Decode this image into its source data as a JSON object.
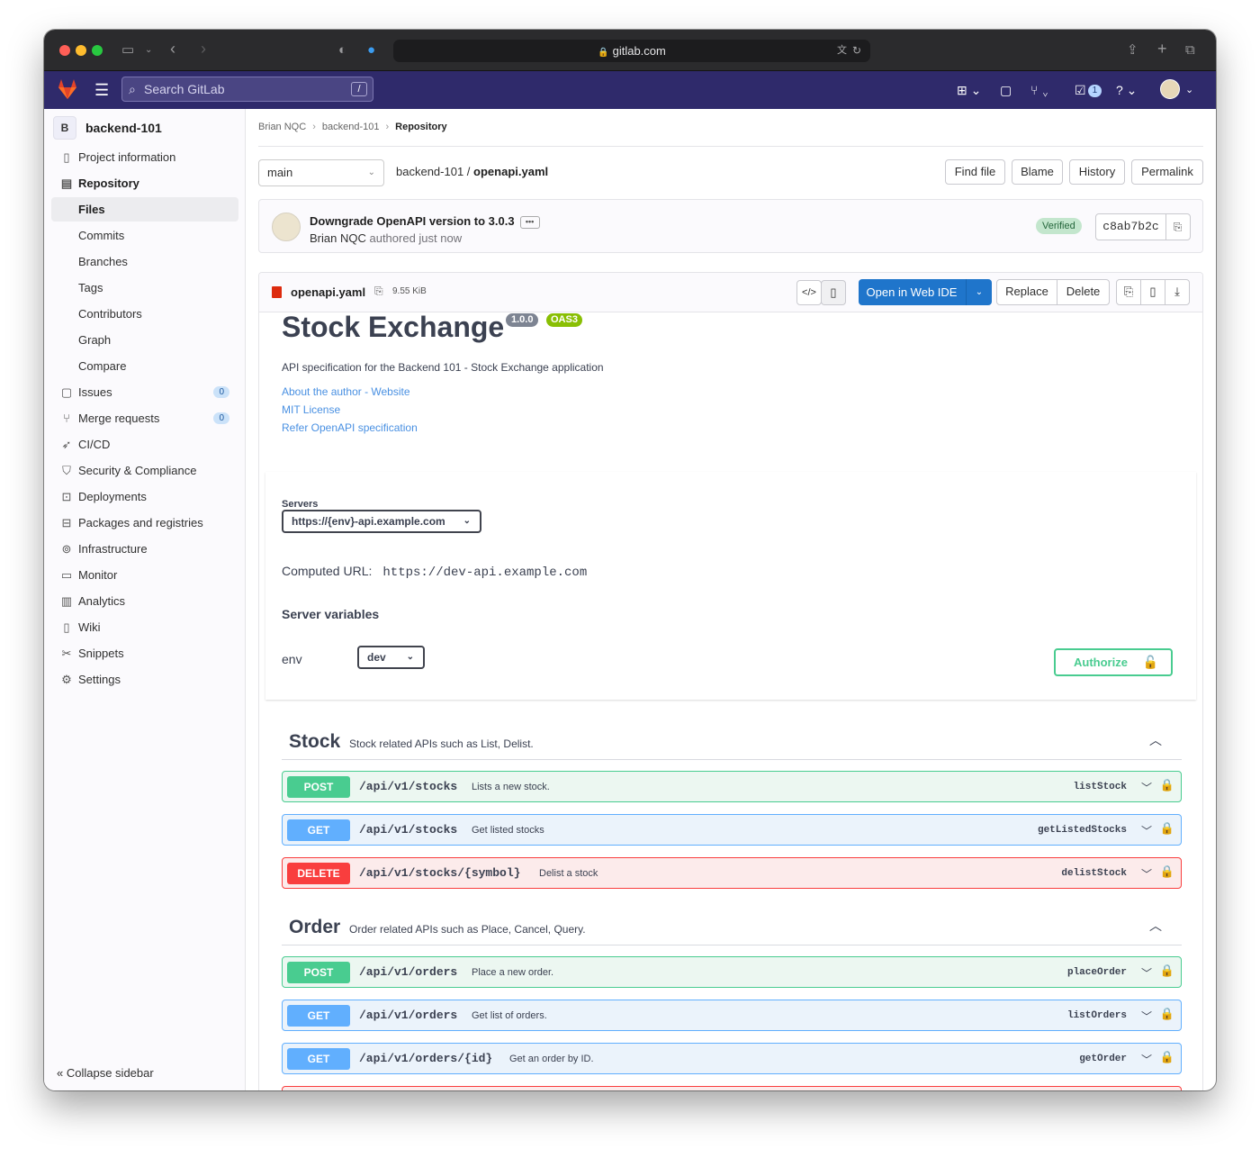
{
  "browser": {
    "url": "gitlab.com"
  },
  "topnav": {
    "search_placeholder": "Search GitLab",
    "search_shortcut": "/",
    "todo_count": "1"
  },
  "sidebar": {
    "project_initial": "B",
    "project_name": "backend-101",
    "items": [
      {
        "label": "Project information",
        "icon": "info-icon"
      },
      {
        "label": "Repository",
        "icon": "doc-icon"
      },
      {
        "label": "Files"
      },
      {
        "label": "Commits"
      },
      {
        "label": "Branches"
      },
      {
        "label": "Tags"
      },
      {
        "label": "Contributors"
      },
      {
        "label": "Graph"
      },
      {
        "label": "Compare"
      },
      {
        "label": "Issues",
        "icon": "issues-icon",
        "badge": "0"
      },
      {
        "label": "Merge requests",
        "icon": "merge-icon",
        "badge": "0"
      },
      {
        "label": "CI/CD",
        "icon": "rocket-icon"
      },
      {
        "label": "Security & Compliance",
        "icon": "shield-icon"
      },
      {
        "label": "Deployments",
        "icon": "deploy-icon"
      },
      {
        "label": "Packages and registries",
        "icon": "package-icon"
      },
      {
        "label": "Infrastructure",
        "icon": "cloud-icon"
      },
      {
        "label": "Monitor",
        "icon": "monitor-icon"
      },
      {
        "label": "Analytics",
        "icon": "chart-icon"
      },
      {
        "label": "Wiki",
        "icon": "book-icon"
      },
      {
        "label": "Snippets",
        "icon": "scissors-icon"
      },
      {
        "label": "Settings",
        "icon": "gear-icon"
      }
    ],
    "collapse_label": "Collapse sidebar"
  },
  "breadcrumb": [
    "Brian NQC",
    "backend-101",
    "Repository"
  ],
  "repo": {
    "branch": "main",
    "path_dir": "backend-101",
    "path_sep": "/",
    "path_file": "openapi.yaml",
    "buttons": {
      "find_file": "Find file",
      "blame": "Blame",
      "history": "History",
      "permalink": "Permalink"
    }
  },
  "commit": {
    "title": "Downgrade OpenAPI version to 3.0.3",
    "author": "Brian NQC",
    "authored": "authored just now",
    "verified": "Verified",
    "sha": "c8ab7b2c"
  },
  "file": {
    "name": "openapi.yaml",
    "size": "9.55 KiB",
    "open_ide": "Open in Web IDE",
    "replace": "Replace",
    "delete": "Delete"
  },
  "swagger": {
    "title": "Stock Exchange",
    "version": "1.0.0",
    "oas": "OAS3",
    "description": "API specification for the Backend 101 - Stock Exchange application",
    "links": [
      "About the author - Website",
      "MIT License",
      "Refer OpenAPI specification"
    ],
    "servers_label": "Servers",
    "server_selected": "https://{env}-api.example.com",
    "computed_url_label": "Computed URL:",
    "computed_url": "https://dev-api.example.com",
    "server_vars_title": "Server variables",
    "env_label": "env",
    "env_value": "dev",
    "authorize": "Authorize",
    "tags": [
      {
        "name": "Stock",
        "description": "Stock related APIs such as List, Delist.",
        "ops": [
          {
            "method": "POST",
            "path": "/api/v1/stocks",
            "summary": "Lists a new stock.",
            "id": "listStock"
          },
          {
            "method": "GET",
            "path": "/api/v1/stocks",
            "summary": "Get listed stocks",
            "id": "getListedStocks"
          },
          {
            "method": "DELETE",
            "path": "/api/v1/stocks/{symbol}",
            "summary": "Delist a stock",
            "id": "delistStock"
          }
        ]
      },
      {
        "name": "Order",
        "description": "Order related APIs such as Place, Cancel, Query.",
        "ops": [
          {
            "method": "POST",
            "path": "/api/v1/orders",
            "summary": "Place a new order.",
            "id": "placeOrder"
          },
          {
            "method": "GET",
            "path": "/api/v1/orders",
            "summary": "Get list of orders.",
            "id": "listOrders"
          },
          {
            "method": "GET",
            "path": "/api/v1/orders/{id}",
            "summary": "Get an order by ID.",
            "id": "getOrder"
          }
        ]
      }
    ]
  },
  "colors": {
    "post": "#49cc90",
    "get": "#61affe",
    "delete": "#f93e3e",
    "gitlab_nav": "#2f2a6b",
    "primary": "#1f75cb"
  }
}
